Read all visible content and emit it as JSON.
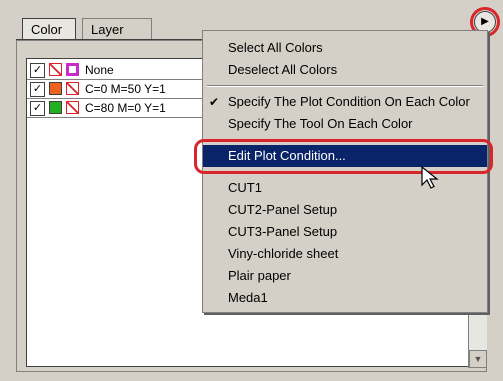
{
  "tabs": [
    {
      "label": "Color"
    },
    {
      "label": "Layer"
    }
  ],
  "list": {
    "rows": [
      {
        "label": "None",
        "checked": "✓",
        "swatch_stroke": "none-red",
        "swatch_fill": "#c82cc8"
      },
      {
        "label": "C=0 M=50 Y=1",
        "checked": "✓",
        "swatch_stroke": "#f06020",
        "swatch_fill": "#f06020"
      },
      {
        "label": "C=80 M=0 Y=1",
        "checked": "✓",
        "swatch_stroke": "#20b020",
        "swatch_fill": "#20b020"
      }
    ]
  },
  "menu": {
    "items": [
      {
        "label": "Select All Colors"
      },
      {
        "label": "Deselect All Colors"
      },
      {
        "label": "Specify The Plot Condition On Each Color",
        "checked": true
      },
      {
        "label": "Specify The Tool On Each Color"
      },
      {
        "label": "Edit Plot Condition...",
        "selected": true
      },
      {
        "label": "CUT1"
      },
      {
        "label": "CUT2-Panel Setup"
      },
      {
        "label": "CUT3-Panel Setup"
      },
      {
        "label": "Viny-chloride sheet"
      },
      {
        "label": "Plair paper"
      },
      {
        "label": "Meda1"
      }
    ]
  },
  "icons": {
    "flyout": "play-circle-icon",
    "check": "checkmark-icon",
    "cursor": "mouse-pointer-icon"
  },
  "colors": {
    "highlight": "#0a246a",
    "callout": "#d9262b"
  }
}
